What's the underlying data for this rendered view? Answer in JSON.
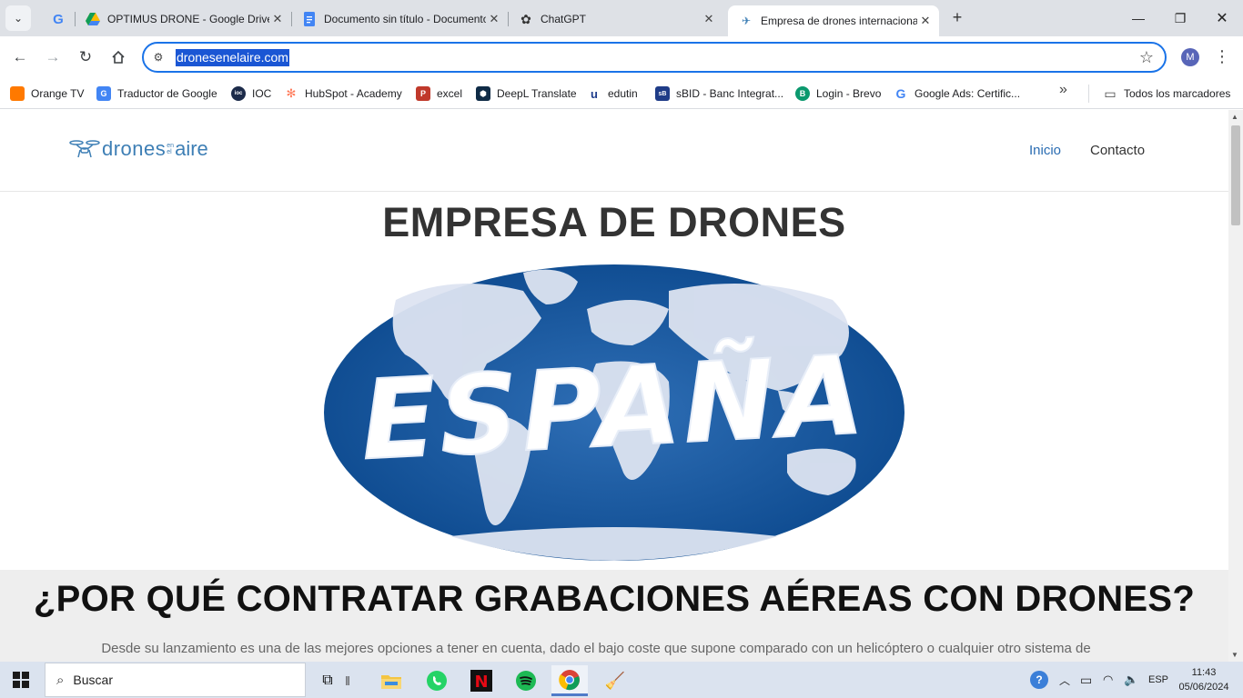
{
  "browser": {
    "tabs": [
      {
        "title": "",
        "icon": "google-icon"
      },
      {
        "title": "OPTIMUS DRONE - Google Drive",
        "icon": "google-drive-icon"
      },
      {
        "title": "Documento sin título - Documentos",
        "icon": "google-docs-icon"
      },
      {
        "title": "ChatGPT",
        "icon": "chatgpt-icon"
      },
      {
        "title": "Empresa de drones internacional",
        "icon": "drone-site-icon",
        "active": true
      }
    ],
    "url": "dronesenelaire.com",
    "profile_initial": "M",
    "bookmarks": [
      {
        "label": "Orange TV",
        "color": "#ff7900"
      },
      {
        "label": "Traductor de Google",
        "color": "#4285f4"
      },
      {
        "label": "IOC",
        "color": "#1c2b4a"
      },
      {
        "label": "HubSpot - Academy",
        "color": "#ff7a59"
      },
      {
        "label": "excel",
        "color": "#c0392b"
      },
      {
        "label": "DeepL Translate",
        "color": "#0f2b46"
      },
      {
        "label": "edutin",
        "color": "#1e3c8c"
      },
      {
        "label": "sBID - Banc Integrat...",
        "color": "#1f3c88"
      },
      {
        "label": "Login - Brevo",
        "color": "#0b996e"
      },
      {
        "label": "Google Ads: Certific...",
        "color": "#4285f4"
      }
    ],
    "all_bookmarks": "Todos los marcadores"
  },
  "site": {
    "logo": {
      "word1": "drones",
      "small_top": "en",
      "small_bottom": "el",
      "word2": "aire"
    },
    "nav": {
      "home": "Inicio",
      "contact": "Contacto"
    },
    "hero_title": "EMPRESA DE DRONES",
    "banner_text": "ESPAÑA",
    "section_title": "¿POR QUÉ CONTRATAR GRABACIONES AÉREAS CON DRONES?",
    "section_text": "Desde su lanzamiento es una de las mejores opciones a tener en cuenta, dado el bajo coste que supone comparado con un helicóptero o cualquier otro sistema de"
  },
  "taskbar": {
    "search_placeholder": "Buscar",
    "language": "ESP",
    "time": "11:43",
    "date": "05/06/2024"
  }
}
